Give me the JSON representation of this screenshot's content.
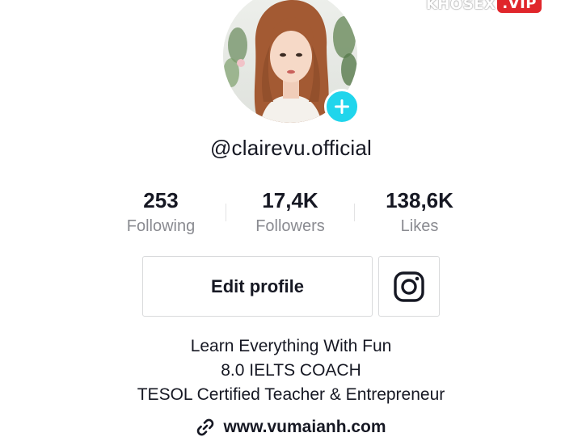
{
  "watermark": {
    "left": "KHOSEX",
    "right": ".VIP"
  },
  "profile": {
    "avatar_icon": "user-avatar-photo",
    "add_badge_icon": "plus-icon",
    "username": "@clairevu.official"
  },
  "stats": [
    {
      "value": "253",
      "label": "Following"
    },
    {
      "value": "17,4K",
      "label": "Followers"
    },
    {
      "value": "138,6K",
      "label": "Likes"
    }
  ],
  "actions": {
    "edit_profile_label": "Edit profile",
    "instagram_icon": "instagram-icon"
  },
  "bio": {
    "lines": [
      "Learn Everything With Fun",
      "8.0 IELTS COACH",
      "TESOL Certified Teacher & Entrepreneur"
    ]
  },
  "link": {
    "icon": "link-icon",
    "text": "www.vumaianh.com"
  },
  "colors": {
    "accent": "#20d5ec",
    "text_primary": "#161823",
    "text_secondary": "#8a8b91",
    "border": "#d9dadc",
    "watermark_red": "#e0262b"
  }
}
